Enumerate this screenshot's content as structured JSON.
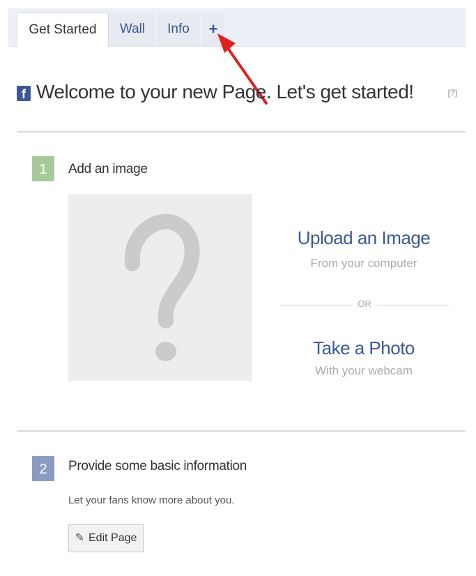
{
  "tabs": [
    {
      "label": "Get Started",
      "active": true
    },
    {
      "label": "Wall",
      "active": false
    },
    {
      "label": "Info",
      "active": false
    },
    {
      "label": "+",
      "active": false
    }
  ],
  "header": {
    "title": "Welcome to your new Page. Let's get started!",
    "help": "[?]",
    "logo": "f"
  },
  "step1": {
    "number": "1",
    "title": "Add an image",
    "upload_label": "Upload an Image",
    "upload_sub": "From your computer",
    "or_label": "OR",
    "photo_label": "Take a Photo",
    "photo_sub": "With your webcam"
  },
  "step2": {
    "number": "2",
    "title": "Provide some basic information",
    "description": "Let your fans know more about you.",
    "button_label": "Edit Page"
  },
  "colors": {
    "brand": "#3b5998",
    "step1": "#a8c99c",
    "step2": "#8c9bc1",
    "arrow": "#e02020"
  }
}
